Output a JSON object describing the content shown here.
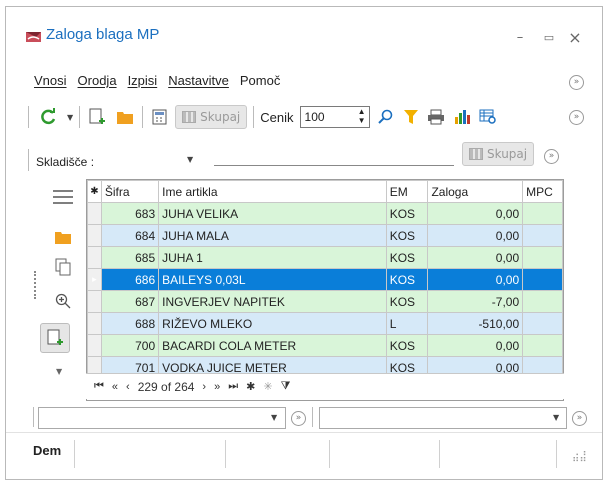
{
  "window": {
    "title": "Zaloga blaga MP",
    "minimize": "–",
    "maximize": "▭",
    "close": "×"
  },
  "menu": [
    {
      "label": "Vnosi"
    },
    {
      "label": "Orodja"
    },
    {
      "label": "Izpisi"
    },
    {
      "label": "Nastavitve"
    },
    {
      "label": "Pomoč"
    }
  ],
  "toolbar": {
    "skupaj_label": "Skupaj",
    "cenik_label": "Cenik",
    "cenik_value": "100"
  },
  "skladisce": {
    "label": "Skladišče :",
    "skupaj_label": "Skupaj"
  },
  "grid": {
    "columns": [
      "Šifra",
      "Ime artikla",
      "EM",
      "Zaloga",
      "MPC"
    ],
    "rows": [
      {
        "sifra": "683",
        "ime": "JUHA VELIKA",
        "em": "KOS",
        "zaloga": "0,00",
        "mpc": "",
        "style": "green"
      },
      {
        "sifra": "684",
        "ime": "JUHA MALA",
        "em": "KOS",
        "zaloga": "0,00",
        "mpc": "",
        "style": "blue"
      },
      {
        "sifra": "685",
        "ime": "JUHA 1",
        "em": "KOS",
        "zaloga": "0,00",
        "mpc": "",
        "style": "green"
      },
      {
        "sifra": "686",
        "ime": "BAILEYS 0,03L",
        "em": "KOS",
        "zaloga": "0,00",
        "mpc": "",
        "style": "sel"
      },
      {
        "sifra": "687",
        "ime": "INGVERJEV NAPITEK",
        "em": "KOS",
        "zaloga": "-7,00",
        "mpc": "",
        "style": "green"
      },
      {
        "sifra": "688",
        "ime": "RIŽEVO MLEKO",
        "em": "L",
        "zaloga": "-510,00",
        "mpc": "",
        "style": "blue"
      },
      {
        "sifra": "700",
        "ime": "BACARDI COLA METER",
        "em": "KOS",
        "zaloga": "0,00",
        "mpc": "",
        "style": "green"
      },
      {
        "sifra": "701",
        "ime": "VODKA JUICE METER",
        "em": "KOS",
        "zaloga": "0,00",
        "mpc": "",
        "style": "blue"
      }
    ],
    "pager": "229 of 264"
  },
  "status": {
    "user": "Dem"
  },
  "colors": {
    "title": "#1b6fbf",
    "selected_row": "#0a7ed9",
    "row_green": "#d9f5d9",
    "row_blue": "#d6e9f8"
  }
}
